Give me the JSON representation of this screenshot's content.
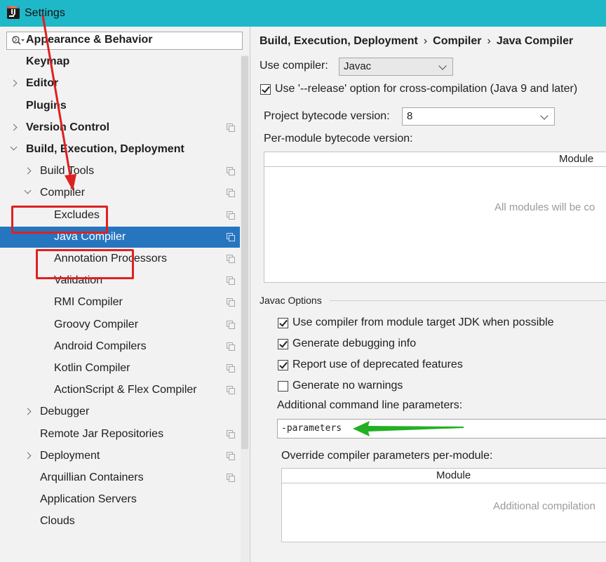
{
  "window": {
    "title": "Settings"
  },
  "search": {
    "value": "",
    "placeholder": ""
  },
  "tree": [
    {
      "label": "Appearance & Behavior",
      "level": 0,
      "bold": true,
      "arrow": "right",
      "copy": false
    },
    {
      "label": "Keymap",
      "level": 0,
      "bold": true,
      "arrow": "none",
      "copy": false
    },
    {
      "label": "Editor",
      "level": 0,
      "bold": true,
      "arrow": "right",
      "copy": false
    },
    {
      "label": "Plugins",
      "level": 0,
      "bold": true,
      "arrow": "none",
      "copy": false
    },
    {
      "label": "Version Control",
      "level": 0,
      "bold": true,
      "arrow": "right",
      "copy": true
    },
    {
      "label": "Build, Execution, Deployment",
      "level": 0,
      "bold": true,
      "arrow": "down",
      "copy": false
    },
    {
      "label": "Build Tools",
      "level": 1,
      "bold": false,
      "arrow": "right",
      "copy": true
    },
    {
      "label": "Compiler",
      "level": 1,
      "bold": false,
      "arrow": "down",
      "copy": true
    },
    {
      "label": "Excludes",
      "level": 2,
      "bold": false,
      "arrow": "none",
      "copy": true
    },
    {
      "label": "Java Compiler",
      "level": 2,
      "bold": false,
      "arrow": "none",
      "copy": true,
      "selected": true
    },
    {
      "label": "Annotation Processors",
      "level": 2,
      "bold": false,
      "arrow": "none",
      "copy": true
    },
    {
      "label": "Validation",
      "level": 2,
      "bold": false,
      "arrow": "none",
      "copy": true
    },
    {
      "label": "RMI Compiler",
      "level": 2,
      "bold": false,
      "arrow": "none",
      "copy": true
    },
    {
      "label": "Groovy Compiler",
      "level": 2,
      "bold": false,
      "arrow": "none",
      "copy": true
    },
    {
      "label": "Android Compilers",
      "level": 2,
      "bold": false,
      "arrow": "none",
      "copy": true
    },
    {
      "label": "Kotlin Compiler",
      "level": 2,
      "bold": false,
      "arrow": "none",
      "copy": true
    },
    {
      "label": "ActionScript & Flex Compiler",
      "level": 2,
      "bold": false,
      "arrow": "none",
      "copy": true
    },
    {
      "label": "Debugger",
      "level": 1,
      "bold": false,
      "arrow": "right",
      "copy": false
    },
    {
      "label": "Remote Jar Repositories",
      "level": 1,
      "bold": false,
      "arrow": "none",
      "copy": true
    },
    {
      "label": "Deployment",
      "level": 1,
      "bold": false,
      "arrow": "right",
      "copy": true
    },
    {
      "label": "Arquillian Containers",
      "level": 1,
      "bold": false,
      "arrow": "none",
      "copy": true
    },
    {
      "label": "Application Servers",
      "level": 1,
      "bold": false,
      "arrow": "none",
      "copy": false
    },
    {
      "label": "Clouds",
      "level": 1,
      "bold": false,
      "arrow": "none",
      "copy": false
    }
  ],
  "breadcrumb": [
    "Build, Execution, Deployment",
    "Compiler",
    "Java Compiler"
  ],
  "breadcrumb_separator": "›",
  "compiler": {
    "use_compiler_label": "Use compiler:",
    "use_compiler_value": "Javac",
    "release_option_label": "Use '--release' option for cross-compilation (Java 9 and later)",
    "release_option_checked": true,
    "bytecode_label": "Project bytecode version:",
    "bytecode_value": "8",
    "per_module_label": "Per-module bytecode version:",
    "module_table_header": "Module",
    "module_table_empty": "All modules will be co"
  },
  "javac": {
    "section_title": "Javac Options",
    "options": [
      {
        "label": "Use compiler from module target JDK when possible",
        "checked": true
      },
      {
        "label": "Generate debugging info",
        "checked": true
      },
      {
        "label": "Report use of deprecated features",
        "checked": true
      },
      {
        "label": "Generate no warnings",
        "checked": false
      }
    ],
    "additional_params_label": "Additional command line parameters:",
    "additional_params_value": "-parameters",
    "override_label": "Override compiler parameters per-module:",
    "override_table_header": "Module",
    "override_table_empty": "Additional compilation"
  },
  "colors": {
    "titlebar": "#1fb8c9",
    "selection": "#2675bf",
    "annotation_red": "#e02020",
    "annotation_green": "#22b022"
  }
}
